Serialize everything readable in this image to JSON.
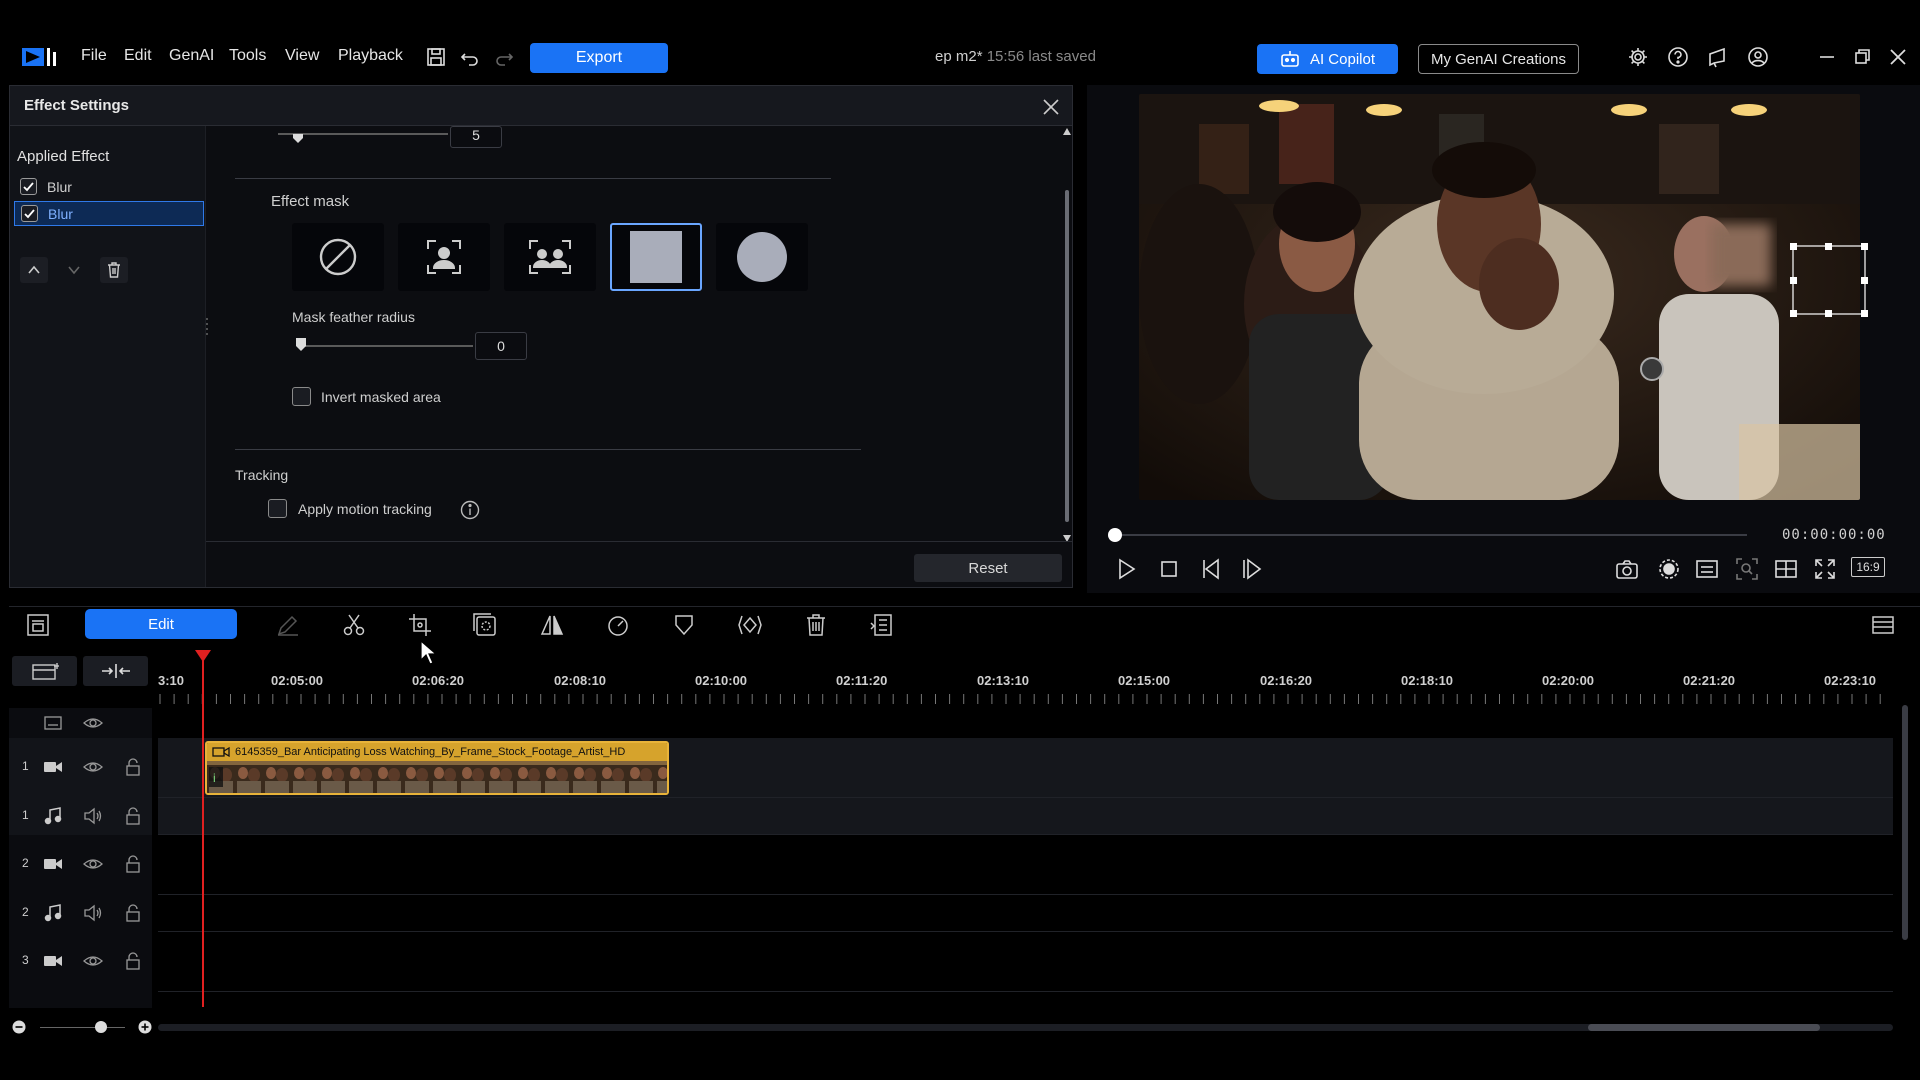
{
  "app": {
    "menu": [
      "File",
      "Edit",
      "GenAI",
      "Tools",
      "View",
      "Playback"
    ],
    "export_label": "Export",
    "project_name": "ep m2*",
    "save_status": "15:56 last saved",
    "ai_copilot_label": "AI Copilot",
    "genai_creations_label": "My GenAI Creations",
    "accent_color": "#1a73f5"
  },
  "effect_panel": {
    "title": "Effect Settings",
    "applied_heading": "Applied Effect",
    "applied_items": [
      {
        "label": "Blur",
        "checked": true,
        "selected": false
      },
      {
        "label": "Blur",
        "checked": true,
        "selected": true
      }
    ],
    "top_value": "5",
    "effect_mask_label": "Effect mask",
    "mask_options": [
      "none-mask-icon",
      "person-mask-icon",
      "group-mask-icon",
      "rectangle-mask-icon",
      "circle-mask-icon"
    ],
    "selected_mask": "rectangle-mask-icon",
    "feather_label": "Mask feather radius",
    "feather_value": "0",
    "invert_label": "Invert masked area",
    "invert_checked": false,
    "tracking_heading": "Tracking",
    "motion_tracking_label": "Apply motion tracking",
    "motion_tracking_checked": false,
    "reset_label": "Reset"
  },
  "preview": {
    "timecode": "00:00:00:00",
    "aspect_label": "16:9",
    "progress": 0
  },
  "timeline": {
    "edit_label": "Edit",
    "ruler_labels": [
      "3:10",
      "02:05:00",
      "02:06:20",
      "02:08:10",
      "02:10:00",
      "02:11:20",
      "02:13:10",
      "02:15:00",
      "02:16:20",
      "02:18:10",
      "02:20:00",
      "02:21:20",
      "02:23:10"
    ],
    "tracks": [
      {
        "num": "1",
        "type": "video"
      },
      {
        "num": "1",
        "type": "audio"
      },
      {
        "num": "2",
        "type": "video"
      },
      {
        "num": "2",
        "type": "audio"
      },
      {
        "num": "3",
        "type": "video"
      }
    ],
    "clip_title": "6145359_Bar Anticipating Loss Watching_By_Frame_Stock_Footage_Artist_HD",
    "clip_color": "#e8b33a"
  }
}
